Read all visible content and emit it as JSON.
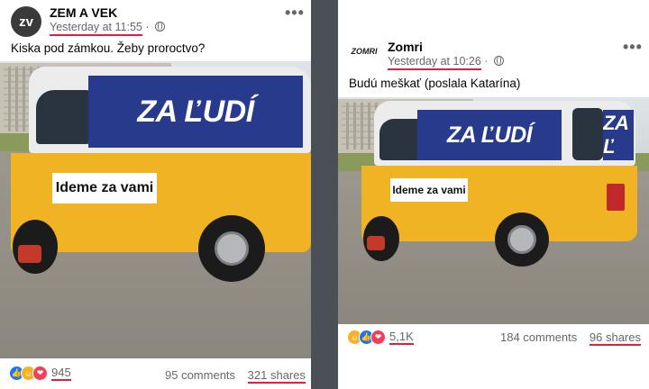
{
  "posts": [
    {
      "author": "ZEM A VEK",
      "timestamp": "Yesterday at 11:55",
      "caption": "Kiska pod zámkou. Žeby proroctvo?",
      "avatar_text": "zv",
      "reaction_count": "945",
      "comments": "95 comments",
      "shares": "321 shares",
      "reactions": [
        "like-icon",
        "haha-icon",
        "love-icon"
      ],
      "photo": {
        "banner": "ZA ĽUDÍ",
        "slogan": "Ideme za vami"
      }
    },
    {
      "author": "Zomri",
      "timestamp": "Yesterday at 10:26",
      "caption": "Budú meškať (poslala Katarína)",
      "avatar_text": "ZOMRI",
      "reaction_count": "5,1K",
      "comments": "184 comments",
      "shares": "96 shares",
      "reactions": [
        "haha-icon",
        "like-icon",
        "love-icon"
      ],
      "photo": {
        "banner": "ZA ĽUDÍ",
        "slogan": "Ideme za vami",
        "side_text": "ZA Ľ"
      }
    }
  ],
  "ui": {
    "more_label": "•••",
    "timestamp_separator": "·"
  },
  "colors": {
    "brand_banner": "#273a8c",
    "van_yellow": "#f0b323",
    "underline": "#e41e3f"
  }
}
